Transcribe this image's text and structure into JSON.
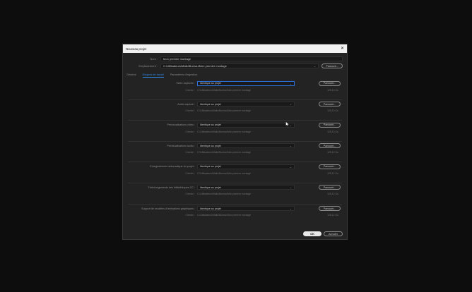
{
  "dialog": {
    "title": "Nouveau projet",
    "name_label": "Nom :",
    "name_value": "Mon premier montage",
    "location_label": "Emplacement :",
    "location_value": "C:\\Utilisateurs\\Mallo\\Bureau\\Mon premier montage",
    "browse_label": "Parcourir...",
    "tabs": [
      "Général",
      "Disques de travail",
      "Paramètres d'ingestion"
    ],
    "ok_label": "OK",
    "cancel_label": "Annuler"
  },
  "sections": [
    {
      "label": "Vidéo capturée :",
      "value": "Identique au projet",
      "path_label": "Chemin :",
      "path": "C:\\Utilisateurs\\Mallo\\Bureau\\Mon premier montage",
      "size": "125,13 Go"
    },
    {
      "label": "Audio capturé :",
      "value": "Identique au projet",
      "path_label": "Chemin :",
      "path": "C:\\Utilisateurs\\Mallo\\Bureau\\Mon premier montage",
      "size": "125,13 Go"
    },
    {
      "label": "Prévisualisations vidéo :",
      "value": "Identique au projet",
      "path_label": "Chemin :",
      "path": "C:\\Utilisateurs\\Mallo\\Bureau\\Mon premier montage",
      "size": "125,13 Go"
    },
    {
      "label": "Prévisualisations audio :",
      "value": "Identique au projet",
      "path_label": "Chemin :",
      "path": "C:\\Utilisateurs\\Mallo\\Bureau\\Mon premier montage",
      "size": "125,12 Go"
    },
    {
      "label": "Enregistrement automatique du projet :",
      "value": "Identique au projet",
      "path_label": "Chemin :",
      "path": "C:\\Utilisateurs\\Mallo\\Bureau\\Mon premier montage",
      "size": "125,12 Go"
    },
    {
      "label": "Téléchargements des bibliothèques CC :",
      "value": "Identique au projet",
      "path_label": "Chemin :",
      "path": "C:\\Utilisateurs\\Mallo\\Bureau\\Mon premier montage",
      "size": "125,12 Go"
    },
    {
      "label": "Support de modèles d'animations graphiques :",
      "value": "Identique au projet",
      "path_label": "Chemin :",
      "path": "C:\\Utilisateurs\\Mallo\\Bureau\\Mon premier montage",
      "size": "125,12 Go"
    }
  ],
  "icons": {
    "close": "close-icon",
    "dropdown": "chevron-down-icon",
    "cursor": "mouse-pointer-icon"
  },
  "colors": {
    "accent": "#2d8ceb",
    "background": "#232323",
    "titlebar": "#f1f1f1"
  }
}
